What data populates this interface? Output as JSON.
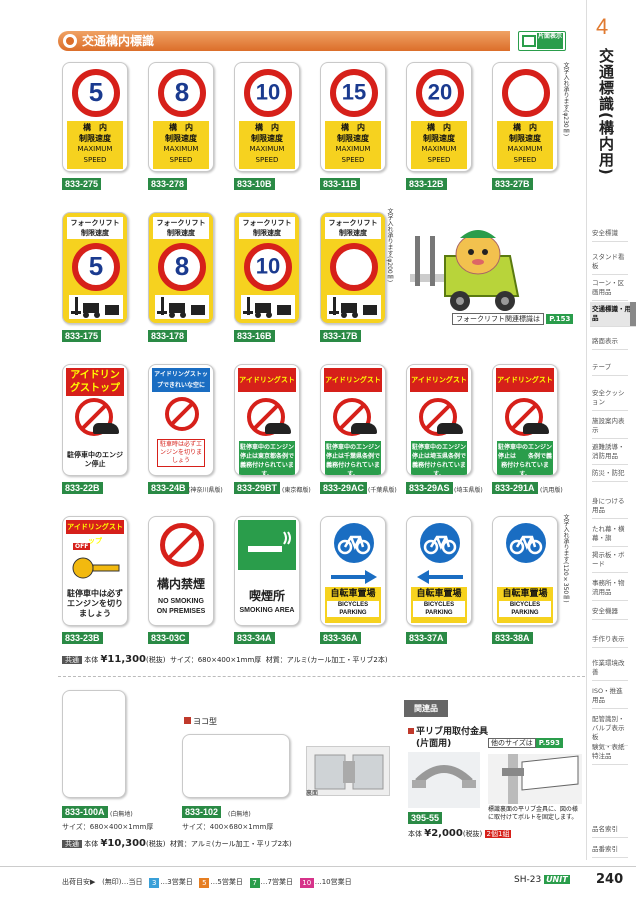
{
  "header": {
    "title": "交通構内標識",
    "badge": "片面表示",
    "chapter_no": "4",
    "chapter_title": "交通標識(構内用)"
  },
  "row1": [
    {
      "num": "5",
      "l1": "構　内",
      "l2": "制限速度",
      "l3": "MAXIMUM",
      "l4": "SPEED",
      "code": "833-275"
    },
    {
      "num": "8",
      "l1": "構　内",
      "l2": "制限速度",
      "l3": "MAXIMUM",
      "l4": "SPEED",
      "code": "833-278"
    },
    {
      "num": "10",
      "l1": "構　内",
      "l2": "制限速度",
      "l3": "MAXIMUM",
      "l4": "SPEED",
      "code": "833-10B"
    },
    {
      "num": "15",
      "l1": "構　内",
      "l2": "制限速度",
      "l3": "MAXIMUM",
      "l4": "SPEED",
      "code": "833-11B"
    },
    {
      "num": "20",
      "l1": "構　内",
      "l2": "制限速度",
      "l3": "MAXIMUM",
      "l4": "SPEED",
      "code": "833-12B"
    },
    {
      "num": "",
      "l1": "構　内",
      "l2": "制限速度",
      "l3": "MAXIMUM",
      "l4": "SPEED",
      "code": "833-27B"
    }
  ],
  "row1_note": "文字入れ承ります(φ230㎜)",
  "row2": [
    {
      "l1": "フォークリフト",
      "l2": "制限速度",
      "num": "5",
      "code": "833-175"
    },
    {
      "l1": "フォークリフト",
      "l2": "制限速度",
      "num": "8",
      "code": "833-178"
    },
    {
      "l1": "フォークリフト",
      "l2": "制限速度",
      "num": "10",
      "code": "833-16B"
    },
    {
      "l1": "フォークリフト",
      "l2": "制限速度",
      "num": "",
      "code": "833-17B"
    }
  ],
  "row2_note": "文字入れ承ります(φ200㎜)",
  "forklift": {
    "label": "フォークリフト関連標識は",
    "page": "P.153"
  },
  "row3": [
    {
      "head": "アイドリングストップ",
      "body": "駐停車中のエンジン停止",
      "code": "833-22B",
      "area": ""
    },
    {
      "head": "アイドリングストップできれいな空に",
      "body": "駐車時は必ずエンジンを切りましょう",
      "code": "833-24B",
      "area": "(神奈川県版)"
    },
    {
      "head": "アイドリングストップ",
      "body": "駐停車中のエンジン停止は東京都条例で義務付けられています。",
      "code": "833-29BT",
      "area": "(東京都版)"
    },
    {
      "head": "アイドリングストップ",
      "body": "駐停車中のエンジン停止は千葉県条例で義務付けられています。",
      "code": "833-29AC",
      "area": "(千葉県版)"
    },
    {
      "head": "アイドリングストップ",
      "body": "駐停車中のエンジン停止は埼玉県条例で義務付けられています。",
      "code": "833-29AS",
      "area": "(埼玉県版)"
    },
    {
      "head": "アイドリングストップ",
      "body": "駐停車中のエンジン停止は　　条例で義務付けられています。",
      "code": "833-291A",
      "area": "(汎用版)"
    }
  ],
  "row4": [
    {
      "head": "アイドリングストップ",
      "body": "駐停車中は必ずエンジンを切りましょう",
      "code": "833-23B",
      "off": "OFF"
    },
    {
      "head": "構内禁煙",
      "body": "NO SMOKING ON PREMISES",
      "code": "833-03C"
    },
    {
      "head": "喫煙所",
      "body": "SMOKING AREA",
      "code": "833-34A"
    },
    {
      "head": "自転車置場",
      "body": "BICYCLES PARKING",
      "code": "833-36A"
    },
    {
      "head": "自転車置場",
      "body": "BICYCLES PARKING",
      "code": "833-37A"
    },
    {
      "head": "自転車置場",
      "body": "BICYCLES PARKING",
      "code": "833-38A"
    }
  ],
  "row4_note": "文字入れ承ります(120×350㎜)",
  "price1": {
    "tag": "共通",
    "label": "本体",
    "price": "¥11,300",
    "tax": "(税抜)",
    "size": "サイズ：680×400×1mm厚",
    "material": "材質：アルミ(カール加工・平リブ2本)"
  },
  "blank1": {
    "code": "833-100A",
    "note": "(白無地)",
    "size": "サイズ：680×400×1mm厚"
  },
  "blank2": {
    "head": "ヨコ型",
    "code": "833-102",
    "note": "(白無地)",
    "size": "サイズ：400×680×1mm厚"
  },
  "back_label": "裏面",
  "price2": {
    "tag": "共通",
    "label": "本体",
    "price": "¥10,300",
    "tax": "(税抜)",
    "material": "材質：アルミ(カール加工・平リブ2本)"
  },
  "related": {
    "tag": "関連品",
    "title1": "平リブ用取付金具",
    "title2": "(片面用)",
    "other": "他のサイズは",
    "page": "P.593",
    "code": "395-55",
    "desc": "標識裏面の平リブ金具に、図の様に取付けてボルトを固定します。",
    "label": "本体",
    "price": "¥2,000",
    "tax": "(税抜)",
    "pair": "2個1組"
  },
  "sidebar": [
    "安全標識",
    "スタンド看板",
    "コーン・区画用品",
    "交通標識・用品",
    "路面表示",
    "テープ",
    "安全クッション",
    "施設案内表示",
    "避難誘導・消防用品",
    "防災・防犯",
    "身につける用品",
    "たれ幕・横幕・旗",
    "掲示板・ボード",
    "事務所・物流用品",
    "安全機器",
    "手作り表示",
    "作業環境改善",
    "ISO・推進用品",
    "配管識別・バルブ表示板",
    "験気・表紙特注品",
    "品名索引",
    "品番索引"
  ],
  "footer": {
    "ship": "出荷目安▶",
    "l0": "(無印)…当日",
    "n3": "3",
    "l3": "…3営業日",
    "n5": "5",
    "l5": "…5営業日",
    "n7": "7",
    "l7": "…7営業日",
    "n10": "10",
    "l10": "…10営業日",
    "page_code": "SH-23",
    "brand": "UNIT",
    "page_no": "240"
  },
  "colors": {
    "accent": "#dc6e2a",
    "green": "#2a8a45",
    "red": "#d6201a",
    "blue": "#1a6dc2",
    "yellow": "#f6d21f"
  }
}
